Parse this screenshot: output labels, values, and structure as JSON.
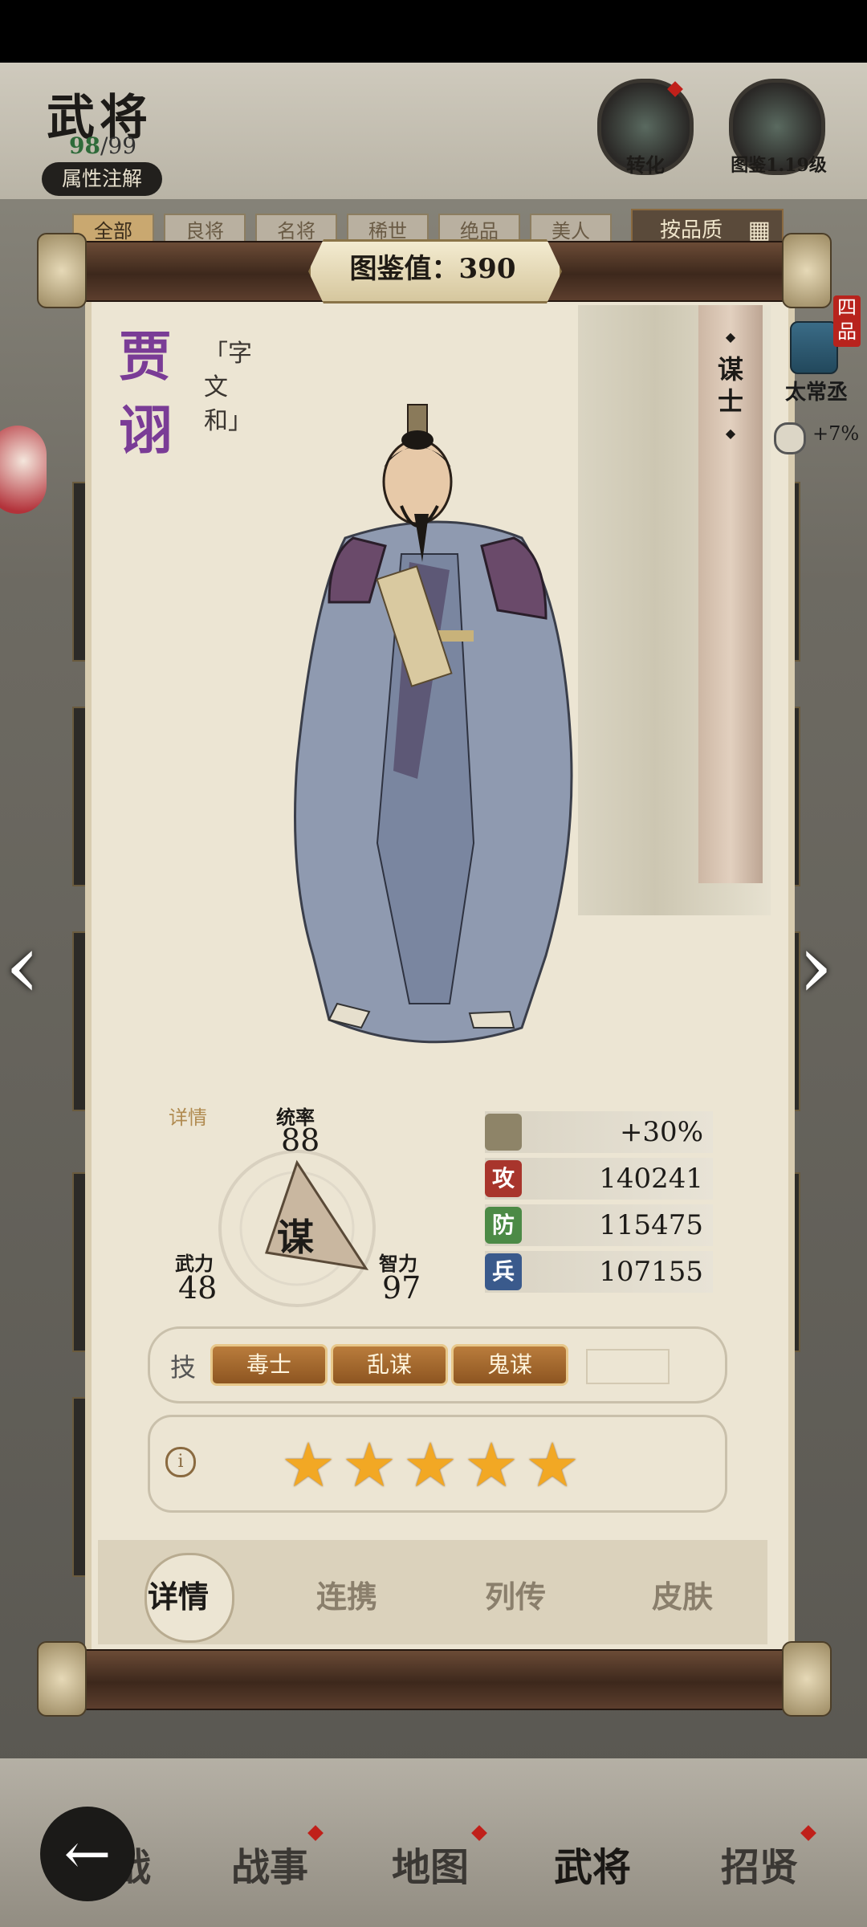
{
  "header": {
    "title": "武将",
    "count_current": "98",
    "count_sep": "/",
    "count_total": "99",
    "attr_button": "属性注解",
    "transform_label": "转化",
    "codex_label": "图鉴1.19级",
    "filter_tabs": [
      "全部",
      "良将",
      "名将",
      "稀世",
      "绝品",
      "美人"
    ],
    "sort_label": "按品质"
  },
  "scroll": {
    "value_label": "图鉴值：390",
    "hero_name": "贾诩",
    "courtesy": "「字 文和」",
    "role": "谋士",
    "rank_badge": "四品",
    "official_title": "太常丞",
    "bonus": "+7%"
  },
  "stats": {
    "details_link": "详情",
    "command_label": "统率",
    "command_value": "88",
    "force_label": "武力",
    "force_value": "48",
    "intellect_label": "智力",
    "intellect_value": "97",
    "class_char": "谋",
    "rows": [
      {
        "icon": "",
        "value": "+30%"
      },
      {
        "icon": "攻",
        "value": "140241"
      },
      {
        "icon": "防",
        "value": "115475"
      },
      {
        "icon": "兵",
        "value": "107155"
      }
    ]
  },
  "skills": {
    "prefix": "技",
    "items": [
      "毒士",
      "乱谋",
      "鬼谋"
    ]
  },
  "stars": {
    "info_icon": "i",
    "count": 5
  },
  "tabs": [
    "详情",
    "连携",
    "列传",
    "皮肤"
  ],
  "nav": {
    "items": [
      "战",
      "战事",
      "地图",
      "武将",
      "招贤"
    ],
    "active": "武将"
  },
  "colors": {
    "name": "#7a3c96",
    "attack": "#a8352c",
    "defense": "#4c8a46",
    "troops": "#3a5a8c",
    "star": "#f2a824"
  }
}
